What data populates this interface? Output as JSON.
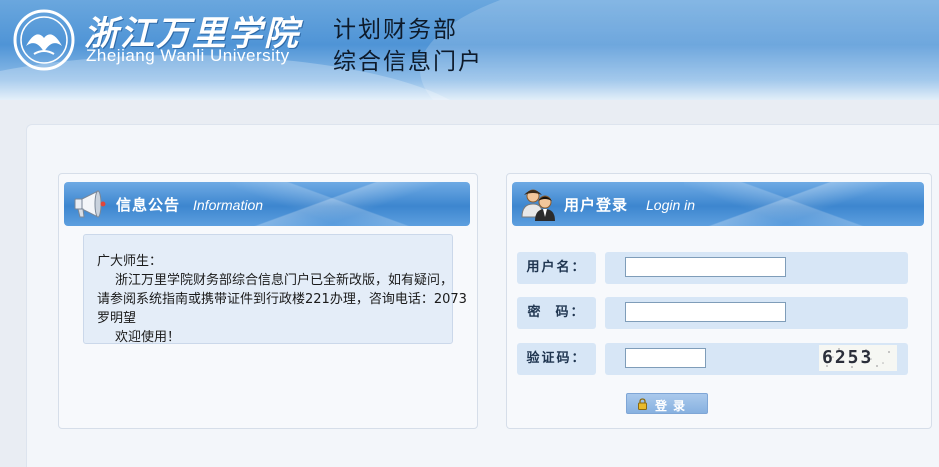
{
  "header": {
    "school_name_cn": "浙江万里学院",
    "school_name_en": "Zhejiang Wanli University",
    "portal_line1": "计划财务部",
    "portal_line2": "综合信息门户"
  },
  "notice": {
    "title": "信息公告",
    "subtitle": "Information",
    "lines": [
      "广大师生：",
      "浙江万里学院财务部综合信息门户已全新改版，如有疑问，",
      "请参阅系统指南或携带证件到行政楼221办理，咨询电话：2073",
      "罗明望",
      "欢迎使用！"
    ]
  },
  "login": {
    "title": "用户登录",
    "subtitle": "Login in",
    "username_label": "用户名：",
    "password_label": "密  码：",
    "captcha_label": "验证码：",
    "username_value": "",
    "password_value": "",
    "captcha_value": "",
    "captcha_text": "6253",
    "submit_label": "登录"
  },
  "colors": {
    "header_blue": "#4f94d6",
    "panel_head_blue": "#3d86cf",
    "field_bg": "#d7e6f6",
    "button_blue": "#87b1e0"
  },
  "icons": {
    "logo": "university-emblem-icon",
    "notice": "megaphone-icon",
    "login": "users-icon",
    "button": "lock-icon"
  }
}
